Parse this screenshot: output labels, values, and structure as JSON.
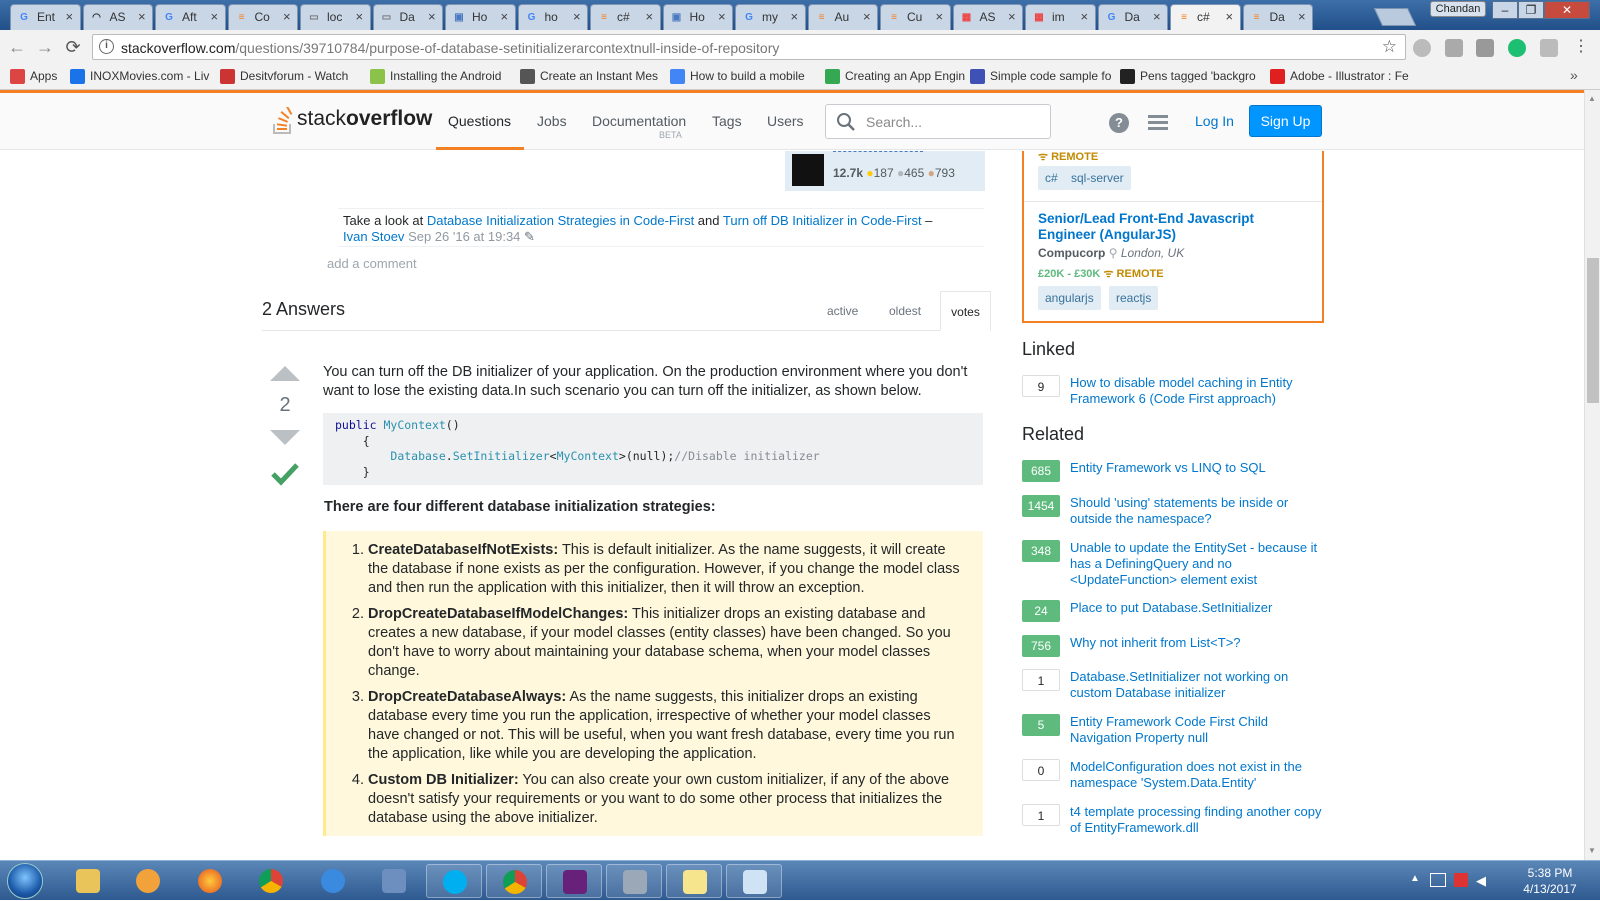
{
  "browser": {
    "tabs": [
      {
        "title": "Ent",
        "color": "#4285f4",
        "glyph": "G"
      },
      {
        "title": "AS",
        "color": "#333",
        "glyph": "◠"
      },
      {
        "title": "Aft",
        "color": "#4285f4",
        "glyph": "G"
      },
      {
        "title": "Co",
        "color": "#f48024",
        "glyph": "≡"
      },
      {
        "title": "loc",
        "color": "#777",
        "glyph": "▭"
      },
      {
        "title": "Da",
        "color": "#777",
        "glyph": "▭"
      },
      {
        "title": "Ho",
        "color": "#4a7abf",
        "glyph": "▣"
      },
      {
        "title": "ho",
        "color": "#4285f4",
        "glyph": "G"
      },
      {
        "title": "c#",
        "color": "#f48024",
        "glyph": "≡"
      },
      {
        "title": "Ho",
        "color": "#4a7abf",
        "glyph": "▣"
      },
      {
        "title": "my",
        "color": "#4285f4",
        "glyph": "G"
      },
      {
        "title": "Au",
        "color": "#f48024",
        "glyph": "≡"
      },
      {
        "title": "Cu",
        "color": "#f48024",
        "glyph": "≡"
      },
      {
        "title": "AS",
        "color": "#e44",
        "glyph": "▦"
      },
      {
        "title": "im",
        "color": "#e44",
        "glyph": "▦"
      },
      {
        "title": "Da",
        "color": "#4285f4",
        "glyph": "G"
      },
      {
        "title": "c#",
        "color": "#f48024",
        "glyph": "≡",
        "active": true
      },
      {
        "title": "Da",
        "color": "#f48024",
        "glyph": "≡"
      }
    ],
    "profile_name": "Chandan",
    "url_host": "stackoverflow.com",
    "url_path": "/questions/39710784/purpose-of-database-setinitializerarcontextnull-inside-of-repository",
    "bookmarks": [
      {
        "label": "Apps",
        "color": "#d44"
      },
      {
        "label": "INOXMovies.com - Liv",
        "color": "#1a73e8"
      },
      {
        "label": "Desitvforum - Watch",
        "color": "#c33"
      },
      {
        "label": "Installing the Android",
        "color": "#8bc34a"
      },
      {
        "label": "Create an Instant Mes",
        "color": "#555"
      },
      {
        "label": "How to build a mobile",
        "color": "#4285f4"
      },
      {
        "label": "Creating an App Engin",
        "color": "#34a853"
      },
      {
        "label": "Simple code sample fo",
        "color": "#3f51b5"
      },
      {
        "label": "Pens tagged 'backgro",
        "color": "#222"
      },
      {
        "label": "Adobe - Illustrator : Fe",
        "color": "#e02020"
      }
    ]
  },
  "so": {
    "logo_light": "stack",
    "logo_bold": "overflow",
    "nav": [
      "Questions",
      "Jobs",
      "Documentation",
      "Tags",
      "Users"
    ],
    "nav_beta": "BETA",
    "search_placeholder": "Search...",
    "help_glyph": "?",
    "login": "Log In",
    "signup": "Sign Up"
  },
  "question": {
    "user_rep": "12.7k",
    "badges": {
      "gold": "187",
      "silver": "465",
      "bronze": "793"
    },
    "comment_prefix": "Take a look at ",
    "comment_link1": "Database Initialization Strategies in Code-First",
    "comment_mid": " and ",
    "comment_link2": "Turn off DB Initializer in Code-First",
    "comment_dash": " –",
    "comment_user": "Ivan Stoev",
    "comment_date": "Sep 26 '16 at 19:34",
    "add_comment": "add a comment"
  },
  "answers": {
    "header": "2 Answers",
    "sort_tabs": [
      "active",
      "oldest",
      "votes"
    ],
    "vote_count": "2",
    "intro": "You can turn off the DB initializer of your application. On the production environment where you don't want to lose the existing data.In such scenario you can turn off the initializer, as shown below.",
    "code_lines": [
      {
        "kw": "public",
        "ty": "MyContext",
        "rest": "()"
      },
      {
        "plain": "    {"
      },
      {
        "indent": "        ",
        "ty": "Database",
        "dot": ".",
        "ty2": "SetInitializer",
        "lt": "<",
        "ty3": "MyContext",
        "gt": ">(null);",
        "cm": "//Disable initializer"
      },
      {
        "plain": "    }"
      }
    ],
    "strategies_heading": "There are four different database initialization strategies:",
    "strategies": [
      {
        "name": "CreateDatabaseIfNotExists:",
        "desc": " This is default initializer. As the name suggests, it will create the database if none exists as per the configuration. However, if you change the model class and then run the application with this initializer, then it will throw an exception."
      },
      {
        "name": "DropCreateDatabaseIfModelChanges:",
        "desc": " This initializer drops an existing database and creates a new database, if your model classes (entity classes) have been changed. So you don't have to worry about maintaining your database schema, when your model classes change."
      },
      {
        "name": "DropCreateDatabaseAlways:",
        "desc": " As the name suggests, this initializer drops an existing database every time you run the application, irrespective of whether your model classes have changed or not. This will be useful, when you want fresh database, every time you run the application, like while you are developing the application."
      },
      {
        "name": "Custom DB Initializer:",
        "desc": " You can also create your own custom initializer, if any of the above doesn't satisfy your requirements or you want to do some other process that initializes the database using the above initializer."
      }
    ]
  },
  "sidebar": {
    "job1": {
      "remote": "REMOTE",
      "tags": [
        "c#",
        "sql-server"
      ]
    },
    "job2": {
      "title": "Senior/Lead Front-End Javascript Engineer (AngularJS)",
      "company": "Compucorp",
      "location": "London, UK",
      "salary": "£20K - £30K",
      "remote": "REMOTE",
      "tags": [
        "angularjs",
        "reactjs"
      ]
    },
    "linked_header": "Linked",
    "linked": [
      {
        "score": "9",
        "accepted": false,
        "title": "How to disable model caching in Entity Framework 6 (Code First approach)"
      }
    ],
    "related_header": "Related",
    "related": [
      {
        "score": "685",
        "accepted": true,
        "title": "Entity Framework vs LINQ to SQL"
      },
      {
        "score": "1454",
        "accepted": true,
        "title": "Should 'using' statements be inside or outside the namespace?"
      },
      {
        "score": "348",
        "accepted": true,
        "title": "Unable to update the EntitySet - because it has a DefiningQuery and no <UpdateFunction> element exist"
      },
      {
        "score": "24",
        "accepted": true,
        "title": "Place to put Database.SetInitializer"
      },
      {
        "score": "756",
        "accepted": true,
        "title": "Why not inherit from List<T>?"
      },
      {
        "score": "1",
        "accepted": false,
        "title": "Database.SetInitializer not working on custom Database initializer"
      },
      {
        "score": "5",
        "accepted": true,
        "title": "Entity Framework Code First Child Navigation Property null"
      },
      {
        "score": "0",
        "accepted": false,
        "title": "ModelConfiguration does not exist in the namespace 'System.Data.Entity'"
      },
      {
        "score": "1",
        "accepted": false,
        "title": "t4 template processing finding another copy of EntityFramework.dll"
      }
    ]
  },
  "taskbar": {
    "time": "5:38 PM",
    "date": "4/13/2017"
  },
  "colors": {
    "accent": "#f48024",
    "link": "#0077cc",
    "accepted": "#5eba7d",
    "primary_button": "#0095ff"
  }
}
